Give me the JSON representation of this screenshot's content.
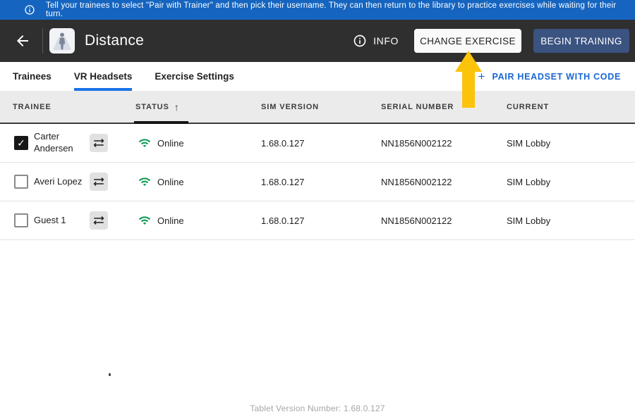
{
  "banner": {
    "text": "Tell your trainees to select \"Pair with Trainer\" and then pick their username. They can then return to the library to practice exercises while waiting for their turn."
  },
  "appbar": {
    "title": "Distance",
    "info_button": "INFO",
    "change_exercise_button": "CHANGE EXERCISE",
    "begin_training_button": "BEGIN TRAINING"
  },
  "tabs": {
    "items": [
      {
        "label": "Trainees",
        "active": false
      },
      {
        "label": "VR Headsets",
        "active": true
      },
      {
        "label": "Exercise Settings",
        "active": false
      }
    ],
    "plus": "+",
    "pair_headset_action": "PAIR HEADSET WITH CODE"
  },
  "table": {
    "headers": {
      "trainee": "TRAINEE",
      "status": "STATUS",
      "sort_arrow": "↑",
      "sim_version": "SIM VERSION",
      "serial_number": "SERIAL NUMBER",
      "current": "CURRENT"
    },
    "sorted_by": "STATUS",
    "sort_direction": "ascending",
    "check_glyph": "✓",
    "rows": [
      {
        "name": "Carter Andersen",
        "checked": true,
        "status": "Online",
        "sim_version": "1.68.0.127",
        "serial_number": "NN1856N002122",
        "current": "SIM Lobby"
      },
      {
        "name": "Averi Lopez",
        "checked": false,
        "status": "Online",
        "sim_version": "1.68.0.127",
        "serial_number": "NN1856N002122",
        "current": "SIM Lobby"
      },
      {
        "name": "Guest 1",
        "checked": false,
        "status": "Online",
        "sim_version": "1.68.0.127",
        "serial_number": "NN1856N002122",
        "current": "SIM Lobby"
      }
    ]
  },
  "footer": {
    "version_text": "Tablet Version Number: 1.68.0.127"
  },
  "colors": {
    "banner_blue": "#1565c0",
    "appbar_dark": "#2f2f30",
    "begin_training_navy": "#3b5381",
    "tab_accent_blue": "#1a73e8",
    "link_blue": "#1967d2",
    "wifi_green": "#0f9d58",
    "arrow_yellow": "#fcc30b"
  }
}
